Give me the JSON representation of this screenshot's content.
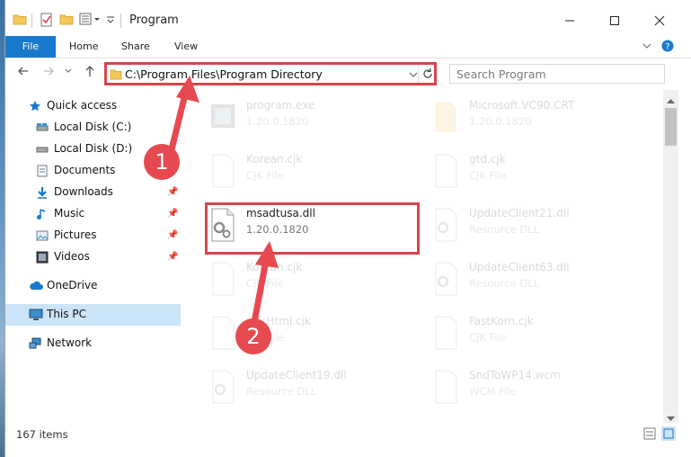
{
  "window": {
    "title": "Program"
  },
  "ribbon": {
    "tabs": [
      {
        "label": "File"
      },
      {
        "label": "Home"
      },
      {
        "label": "Share"
      },
      {
        "label": "View"
      }
    ]
  },
  "address": {
    "path": "C:\\Program Files\\Program Directory"
  },
  "search": {
    "placeholder": "Search Program"
  },
  "sidebar": {
    "items": [
      {
        "label": "Quick access",
        "icon": "star-icon"
      },
      {
        "label": "Local Disk (C:)",
        "icon": "drive-icon"
      },
      {
        "label": "Local Disk (D:)",
        "icon": "drive-icon"
      },
      {
        "label": "Documents",
        "icon": "document-icon"
      },
      {
        "label": "Downloads",
        "icon": "download-icon"
      },
      {
        "label": "Music",
        "icon": "music-icon"
      },
      {
        "label": "Pictures",
        "icon": "picture-icon"
      },
      {
        "label": "Videos",
        "icon": "video-icon"
      },
      {
        "label": "OneDrive",
        "icon": "cloud-icon"
      },
      {
        "label": "This PC",
        "icon": "computer-icon"
      },
      {
        "label": "Network",
        "icon": "network-icon"
      }
    ]
  },
  "files": [
    {
      "name": "program.exe",
      "desc": "1.20.0.1820"
    },
    {
      "name": "Microsoft.VC90.CRT",
      "desc": "1.20.0.1820"
    },
    {
      "name": "Korean.cjk",
      "desc": "CJK File"
    },
    {
      "name": "gtd.cjk",
      "desc": "CJK File"
    },
    {
      "name": "msadtusa.dll",
      "desc": "1.20.0.1820"
    },
    {
      "name": "UpdateClient21.dll",
      "desc": "Resource DLL"
    },
    {
      "name": "Korean.cjk",
      "desc": "CJK File"
    },
    {
      "name": "UpdateClient63.dll",
      "desc": "Resource DLL"
    },
    {
      "name": "mfcHtml.cjk",
      "desc": "CJK File"
    },
    {
      "name": "FastKorn.cjk",
      "desc": "CJK File"
    },
    {
      "name": "UpdateClient19.dll",
      "desc": "Resource DLL"
    },
    {
      "name": "SndToWP14.wcm",
      "desc": "WCM File"
    }
  ],
  "status": {
    "item_count": "167 items"
  },
  "annotations": {
    "step1": "1",
    "step2": "2"
  },
  "colors": {
    "accent": "#1979ca",
    "annotation": "#e64a50"
  }
}
